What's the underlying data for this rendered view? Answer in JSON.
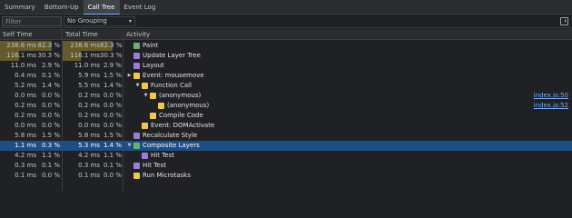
{
  "tabs": [
    {
      "label": "Summary",
      "active": false
    },
    {
      "label": "Bottom-Up",
      "active": false
    },
    {
      "label": "Call Tree",
      "active": true
    },
    {
      "label": "Event Log",
      "active": false
    }
  ],
  "toolbar": {
    "filter_placeholder": "Filter",
    "grouping_value": "No Grouping",
    "grouping_chevron": "▾"
  },
  "columns": {
    "self_time": "Self Time",
    "total_time": "Total Time",
    "activity": "Activity"
  },
  "colors": {
    "rendering": "#9b7dd8",
    "painting": "#6ab36e",
    "scripting": "#f2c84b",
    "selected_row": "#1f4d86",
    "heat_bar": "#645a2b"
  },
  "rows": [
    {
      "self_ms": "238.6 ms",
      "self_pct": "82.3 %",
      "total_ms": "238.6 ms",
      "total_pct": "82.3 %",
      "name": "Paint",
      "category": "painting",
      "depth": 0,
      "expander": "",
      "source": "",
      "self_fraction": 0.823,
      "total_fraction": 0.823,
      "selected": false
    },
    {
      "self_ms": "116.1 ms",
      "self_pct": "30.3 %",
      "total_ms": "116.1 ms",
      "total_pct": "30.3 %",
      "name": "Update Layer Tree",
      "category": "rendering",
      "depth": 0,
      "expander": "",
      "source": "",
      "self_fraction": 0.303,
      "total_fraction": 0.303,
      "selected": false
    },
    {
      "self_ms": "11.0 ms",
      "self_pct": "2.9 %",
      "total_ms": "11.0 ms",
      "total_pct": "2.9 %",
      "name": "Layout",
      "category": "rendering",
      "depth": 0,
      "expander": "",
      "source": "",
      "self_fraction": 0.0,
      "total_fraction": 0.0,
      "selected": false
    },
    {
      "self_ms": "0.4 ms",
      "self_pct": "0.1 %",
      "total_ms": "5.9 ms",
      "total_pct": "1.5 %",
      "name": "Event: mousemove",
      "category": "scripting",
      "depth": 0,
      "expander": "▶",
      "source": "",
      "self_fraction": 0.0,
      "total_fraction": 0.0,
      "selected": false
    },
    {
      "self_ms": "5.2 ms",
      "self_pct": "1.4 %",
      "total_ms": "5.5 ms",
      "total_pct": "1.4 %",
      "name": "Function Call",
      "category": "scripting",
      "depth": 1,
      "expander": "▼",
      "source": "",
      "self_fraction": 0.0,
      "total_fraction": 0.0,
      "selected": false
    },
    {
      "self_ms": "0.0 ms",
      "self_pct": "0.0 %",
      "total_ms": "0.2 ms",
      "total_pct": "0.0 %",
      "name": "(anonymous)",
      "category": "scripting",
      "depth": 2,
      "expander": "▼",
      "source": "index.js:50",
      "self_fraction": 0.0,
      "total_fraction": 0.0,
      "selected": false
    },
    {
      "self_ms": "0.2 ms",
      "self_pct": "0.0 %",
      "total_ms": "0.2 ms",
      "total_pct": "0.0 %",
      "name": "(anonymous)",
      "category": "scripting",
      "depth": 3,
      "expander": "",
      "source": "index.js:52",
      "self_fraction": 0.0,
      "total_fraction": 0.0,
      "selected": false
    },
    {
      "self_ms": "0.2 ms",
      "self_pct": "0.0 %",
      "total_ms": "0.2 ms",
      "total_pct": "0.0 %",
      "name": "Compile Code",
      "category": "scripting",
      "depth": 2,
      "expander": "",
      "source": "",
      "self_fraction": 0.0,
      "total_fraction": 0.0,
      "selected": false
    },
    {
      "self_ms": "0.0 ms",
      "self_pct": "0.0 %",
      "total_ms": "0.0 ms",
      "total_pct": "0.0 %",
      "name": "Event: DOMActivate",
      "category": "scripting",
      "depth": 1,
      "expander": "",
      "source": "",
      "self_fraction": 0.0,
      "total_fraction": 0.0,
      "selected": false
    },
    {
      "self_ms": "5.8 ms",
      "self_pct": "1.5 %",
      "total_ms": "5.8 ms",
      "total_pct": "1.5 %",
      "name": "Recalculate Style",
      "category": "rendering",
      "depth": 0,
      "expander": "",
      "source": "",
      "self_fraction": 0.0,
      "total_fraction": 0.0,
      "selected": false
    },
    {
      "self_ms": "1.1 ms",
      "self_pct": "0.3 %",
      "total_ms": "5.3 ms",
      "total_pct": "1.4 %",
      "name": "Composite Layers",
      "category": "painting",
      "depth": 0,
      "expander": "▼",
      "source": "",
      "self_fraction": 0.0,
      "total_fraction": 0.0,
      "selected": true
    },
    {
      "self_ms": "4.2 ms",
      "self_pct": "1.1 %",
      "total_ms": "4.2 ms",
      "total_pct": "1.1 %",
      "name": "Hit Test",
      "category": "rendering",
      "depth": 1,
      "expander": "",
      "source": "",
      "self_fraction": 0.0,
      "total_fraction": 0.0,
      "selected": false
    },
    {
      "self_ms": "0.3 ms",
      "self_pct": "0.1 %",
      "total_ms": "0.3 ms",
      "total_pct": "0.1 %",
      "name": "Hit Test",
      "category": "rendering",
      "depth": 0,
      "expander": "",
      "source": "",
      "self_fraction": 0.0,
      "total_fraction": 0.0,
      "selected": false
    },
    {
      "self_ms": "0.1 ms",
      "self_pct": "0.0 %",
      "total_ms": "0.1 ms",
      "total_pct": "0.0 %",
      "name": "Run Microtasks",
      "category": "scripting",
      "depth": 0,
      "expander": "",
      "source": "",
      "self_fraction": 0.0,
      "total_fraction": 0.0,
      "selected": false
    }
  ]
}
